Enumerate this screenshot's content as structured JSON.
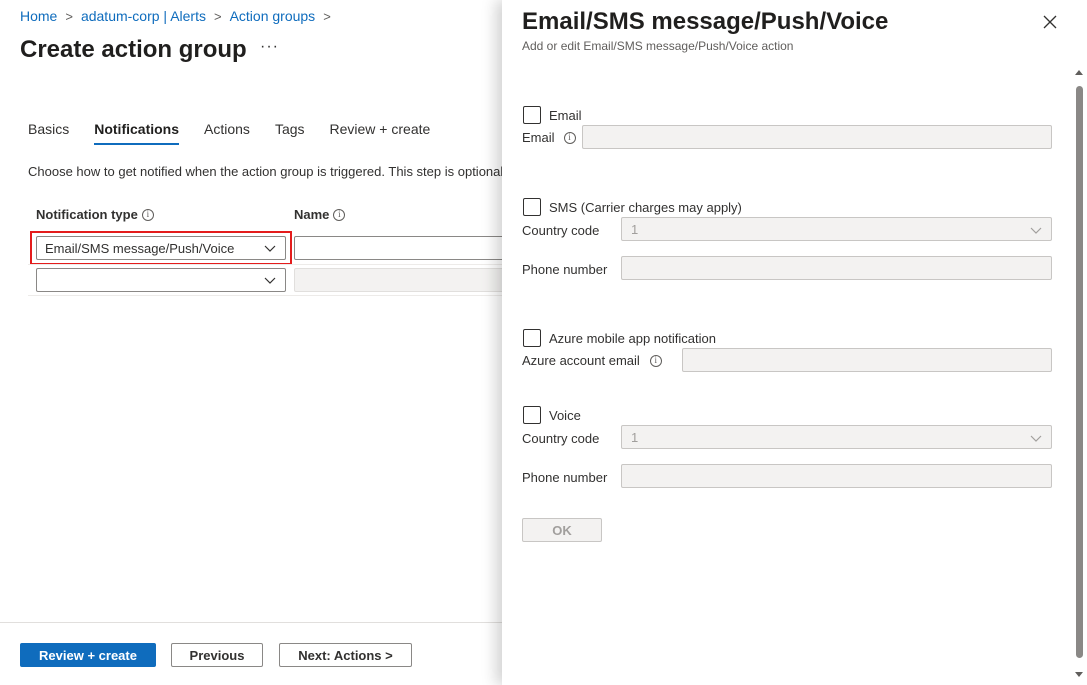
{
  "breadcrumb": {
    "items": [
      "Home",
      "adatum-corp | Alerts",
      "Action groups"
    ],
    "separator": ">"
  },
  "page": {
    "title": "Create action group",
    "more": "···"
  },
  "tabs": [
    {
      "label": "Basics",
      "active": false
    },
    {
      "label": "Notifications",
      "active": true
    },
    {
      "label": "Actions",
      "active": false
    },
    {
      "label": "Tags",
      "active": false
    },
    {
      "label": "Review + create",
      "active": false
    }
  ],
  "notifications": {
    "description": "Choose how to get notified when the action group is triggered. This step is optional.",
    "columns": {
      "type": "Notification type",
      "name": "Name"
    },
    "rows": [
      {
        "type": "Email/SMS message/Push/Voice",
        "name": ""
      },
      {
        "type": "",
        "name": ""
      }
    ]
  },
  "footer": {
    "review_create": "Review + create",
    "previous": "Previous",
    "next": "Next: Actions >"
  },
  "panel": {
    "title": "Email/SMS message/Push/Voice",
    "subtitle": "Add or edit Email/SMS message/Push/Voice action",
    "email": {
      "checkbox_label": "Email",
      "field_label": "Email",
      "value": ""
    },
    "sms": {
      "checkbox_label": "SMS (Carrier charges may apply)",
      "country_label": "Country code",
      "country_value": "1",
      "phone_label": "Phone number",
      "phone_value": ""
    },
    "push": {
      "checkbox_label": "Azure mobile app notification",
      "field_label": "Azure account email",
      "value": ""
    },
    "voice": {
      "checkbox_label": "Voice",
      "country_label": "Country code",
      "country_value": "1",
      "phone_label": "Phone number",
      "phone_value": ""
    },
    "ok_label": "OK"
  },
  "icons": {
    "info": "i",
    "close": "close-icon",
    "chevron": "chevron-down-icon"
  },
  "colors": {
    "accent": "#0f6cbd",
    "highlight_border": "#e41c1c"
  }
}
